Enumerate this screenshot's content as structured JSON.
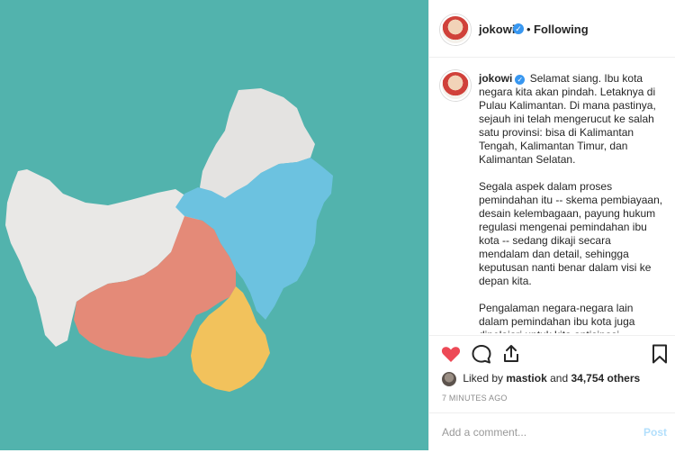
{
  "post": {
    "username": "jokowi",
    "follow_status": "Following",
    "verified_glyph": "✓",
    "separator": "•"
  },
  "caption": {
    "username": "jokowi",
    "paragraphs": [
      "Selamat siang. Ibu kota negara kita akan pindah. Letaknya di Pulau Kalimantan. Di mana pastinya, sejauh ini telah mengerucut ke salah satu provinsi: bisa di Kalimantan Tengah, Kalimantan Timur, dan Kalimantan Selatan.",
      "Segala aspek dalam proses pemindahan itu -- skema pembiayaan, desain kelembagaan, payung hukum regulasi mengenai pemindahan ibu kota -- sedang dikaji secara mendalam dan detail, sehingga keputusan nanti benar dalam visi ke depan kita.",
      "Pengalaman negara-negara lain dalam pemindahan ibu kota juga dipelajari untuk kita antisipasi hambatannya. Sebaliknya, faktor-faktor kunci"
    ]
  },
  "likes": {
    "prefix": "Liked by",
    "liker": "mastiok",
    "conjunction": "and",
    "count_text": "34,754 others"
  },
  "timestamp": "7 MINUTES AGO",
  "comment": {
    "placeholder": "Add a comment...",
    "post_label": "Post"
  },
  "icons": {
    "like": "heart-icon",
    "comment": "comment-icon",
    "share": "share-icon",
    "save": "bookmark-icon"
  },
  "colors": {
    "background": "#52b3ad",
    "west": "#e9e8e6",
    "north": "#e4e3e1",
    "east": "#6cc2e0",
    "central": "#e48a78",
    "south": "#f2c25c",
    "heart": "#ed4956",
    "verified": "#3897f0",
    "post_disabled": "#b2dffc"
  }
}
